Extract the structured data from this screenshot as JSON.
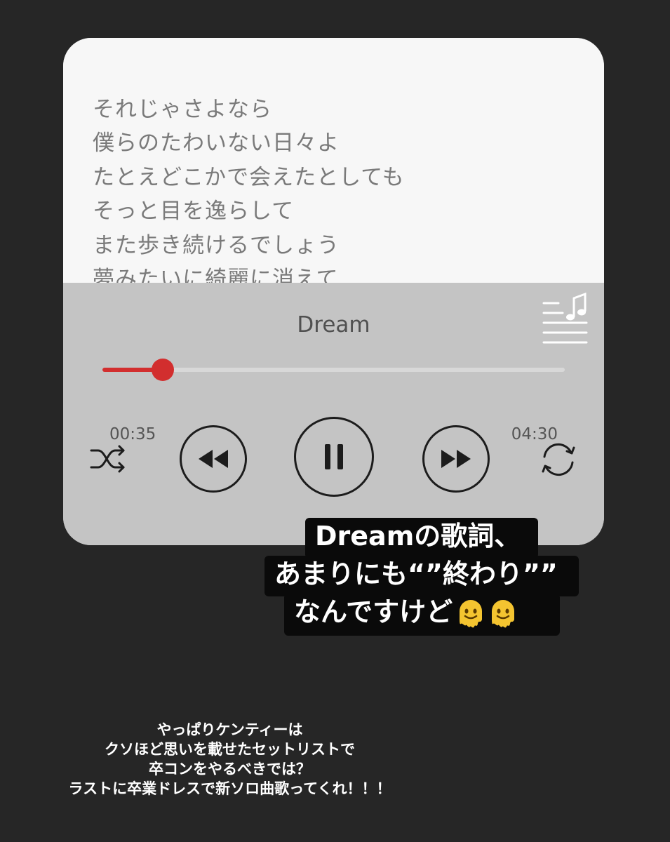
{
  "lyrics": {
    "lines": [
      "それじゃさよなら",
      "僕らのたわいない日々よ",
      "たとえどこかで会えたとしても",
      "そっと目を逸らして",
      "また歩き続けるでしょう",
      "夢みたいに綺麗に消えて..."
    ]
  },
  "player": {
    "song_title": "Dream",
    "elapsed": "00:35",
    "duration": "04:30",
    "progress_fraction": 0.13,
    "accent_color": "#d22e2e",
    "icons": {
      "lyrics": "lyrics-list-music-note-icon",
      "shuffle": "shuffle-icon",
      "rewind": "rewind-icon",
      "pause": "pause-icon",
      "fast_forward": "fast-forward-icon",
      "repeat": "repeat-icon"
    }
  },
  "caption": {
    "lines": [
      "Dreamの歌詞、",
      "あまりにも“”終わり””",
      "なんですけど"
    ],
    "emoji": "melting-face-emoji"
  },
  "footer_text": {
    "lines": [
      "やっぱりケンティーは",
      "クソほど思いを載せたセットリストで",
      "卒コンをやるべきでは？",
      "ラストに卒業ドレスで新ソロ曲歌ってくれ！！！"
    ]
  }
}
